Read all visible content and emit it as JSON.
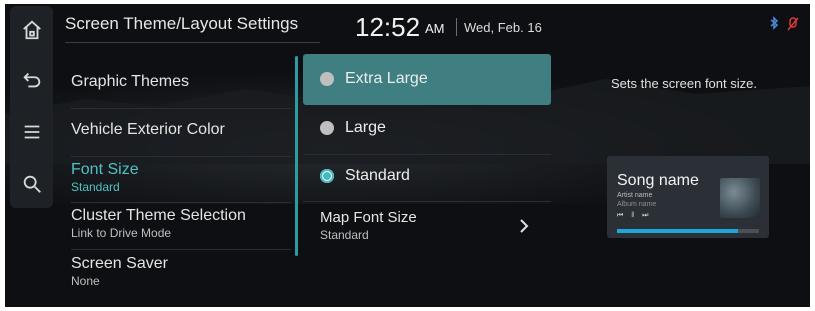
{
  "header": {
    "title": "Screen Theme/Layout Settings",
    "time": "12:52",
    "ampm": "AM",
    "date": "Wed, Feb. 16"
  },
  "rail": {
    "icons": [
      "home-icon",
      "back-icon",
      "menu-icon",
      "search-icon"
    ]
  },
  "status": {
    "icons": [
      "bluetooth-icon",
      "mic-off-icon"
    ],
    "colors": {
      "bluetooth": "#4a86d6",
      "mic_off": "#e03a3a"
    }
  },
  "menu": {
    "items": [
      {
        "label": "Graphic Themes",
        "sub": ""
      },
      {
        "label": "Vehicle Exterior Color",
        "sub": ""
      },
      {
        "label": "Font Size",
        "sub": "Standard",
        "active": true
      },
      {
        "label": "Cluster Theme Selection",
        "sub": "Link to Drive Mode"
      },
      {
        "label": "Screen Saver",
        "sub": "None"
      }
    ]
  },
  "options": {
    "font_sizes": [
      {
        "label": "Extra Large",
        "state": "highlighted"
      },
      {
        "label": "Large",
        "state": "unselected"
      },
      {
        "label": "Standard",
        "state": "selected"
      }
    ],
    "map_font": {
      "label": "Map Font Size",
      "value": "Standard"
    }
  },
  "preview": {
    "description": "Sets the screen font size.",
    "song": "Song name",
    "artist": "Artist name",
    "album": "Album name",
    "controls": "⏮ ‖ ⏭",
    "progress": 0.85
  },
  "colors": {
    "accent": "#4fc2c6",
    "selected_bg": "#3f7f82",
    "background": "#0d0f12"
  }
}
